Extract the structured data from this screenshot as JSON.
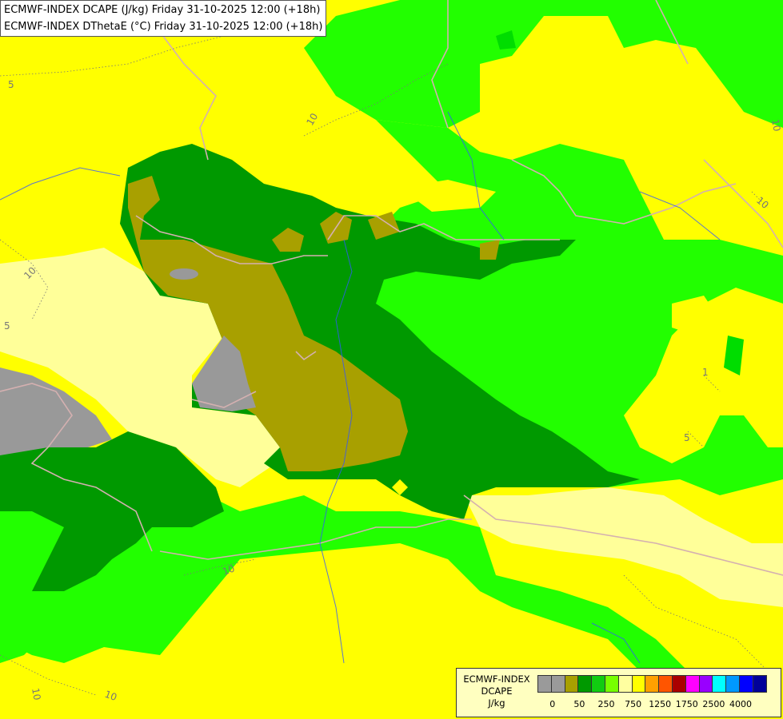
{
  "header": {
    "line1": "ECMWF-INDEX DCAPE (J/kg) Friday 31-10-2025 12:00 (+18h)",
    "line2": "ECMWF-INDEX DThetaE (°C) Friday 31-10-2025 12:00 (+18h)"
  },
  "legend": {
    "title1": "ECMWF-INDEX",
    "title2": "DCAPE",
    "unit": "J/kg",
    "colors": [
      "#9a9a9a",
      "#9a9a9a",
      "#a8a000",
      "#009900",
      "#11cc11",
      "#77ff00",
      "#ffffa0",
      "#ffff00",
      "#ffa000",
      "#ff5500",
      "#aa0000",
      "#ff00ff",
      "#9900ff",
      "#00ffff",
      "#0099ff",
      "#0000ff",
      "#000099"
    ],
    "ticks": [
      "0",
      "50",
      "250",
      "750",
      "1250",
      "1750",
      "2500",
      "4000"
    ]
  },
  "contours": {
    "labels": [
      "10",
      "10",
      "10",
      "10",
      "10",
      "5",
      "5",
      "5",
      "10",
      "10",
      "1"
    ]
  },
  "colors": {
    "yellow": "#ffff00",
    "pale_yellow": "#ffff99",
    "light_green": "#22ff00",
    "green": "#00dd00",
    "dark_green": "#009900",
    "olive": "#a8a000",
    "gray": "#999999",
    "border": "#c8a0a0",
    "river": "#3355ff"
  }
}
